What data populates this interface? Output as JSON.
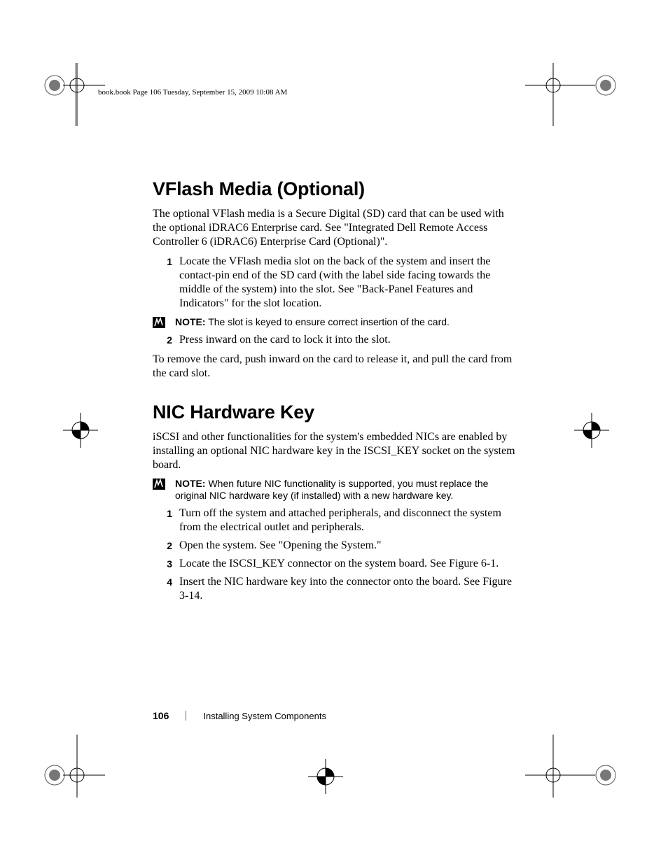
{
  "header": {
    "running_head": "book.book  Page 106  Tuesday, September 15, 2009  10:08 AM"
  },
  "sections": [
    {
      "title": "VFlash Media (Optional)",
      "intro": "The optional VFlash media is a Secure Digital (SD) card that can be used with the optional iDRAC6 Enterprise card. See \"Integrated Dell Remote Access Controller 6 (iDRAC6) Enterprise Card (Optional)\".",
      "steps": [
        "Locate the VFlash media slot on the back of the system and insert the contact-pin end of the SD card (with the label side facing towards the middle of the system) into the slot. See \"Back-Panel Features and Indicators\" for the slot location."
      ],
      "note_label": "NOTE:",
      "note": "The slot is keyed to ensure correct insertion of the card.",
      "steps2": [
        "Press inward on the card to lock it into the slot."
      ],
      "outro": "To remove the card, push inward on the card to release it, and pull the card from the card slot."
    },
    {
      "title": "NIC Hardware Key",
      "intro": "iSCSI and other functionalities for the system's embedded NICs are enabled by installing an optional NIC hardware key in the ISCSI_KEY socket on the system board.",
      "note_label": "NOTE:",
      "note": "When future NIC functionality is supported, you must replace the original NIC hardware key (if installed) with a new hardware key.",
      "steps": [
        "Turn off the system and attached peripherals, and disconnect the system from the electrical outlet and peripherals.",
        "Open the system. See \"Opening the System.\"",
        "Locate the ISCSI_KEY connector on the system board. See Figure 6-1.",
        "Insert the NIC hardware key into the connector onto the board. See Figure 3-14."
      ]
    }
  ],
  "footer": {
    "page_number": "106",
    "section_name": "Installing System Components"
  }
}
